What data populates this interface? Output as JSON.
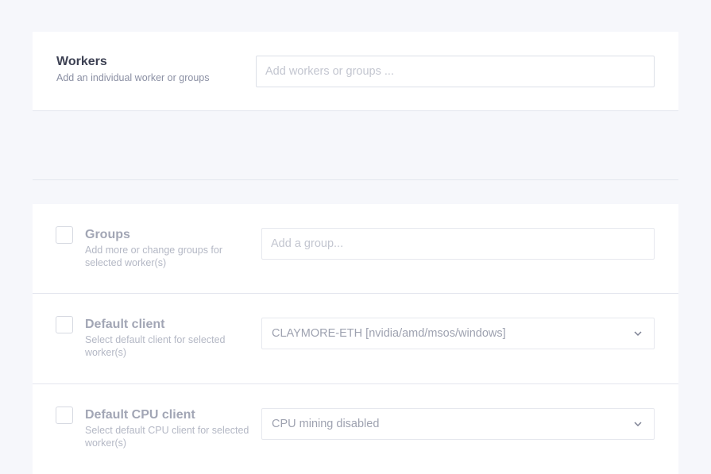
{
  "workers": {
    "title": "Workers",
    "subtitle": "Add an individual worker or groups",
    "placeholder": "Add workers or groups ..."
  },
  "groups": {
    "title": "Groups",
    "subtitle_line1": "Add more or change groups for",
    "subtitle_line2": "selected worker(s)",
    "placeholder": "Add a group..."
  },
  "default_client": {
    "title": "Default client",
    "subtitle_line1": "Select default client for selected",
    "subtitle_line2": "worker(s)",
    "value": "CLAYMORE-ETH [nvidia/amd/msos/windows]",
    "icon": "chevron-down-icon"
  },
  "default_cpu_client": {
    "title": "Default CPU client",
    "subtitle_line1": "Select default CPU client for selected",
    "subtitle_line2": "worker(s)",
    "value": "CPU mining disabled",
    "icon": "chevron-down-icon"
  },
  "colors": {
    "background": "#f6f7fb",
    "card": "#ffffff",
    "border": "#e3e6ee",
    "title": "#3d4153",
    "muted": "#8a8fa3"
  }
}
